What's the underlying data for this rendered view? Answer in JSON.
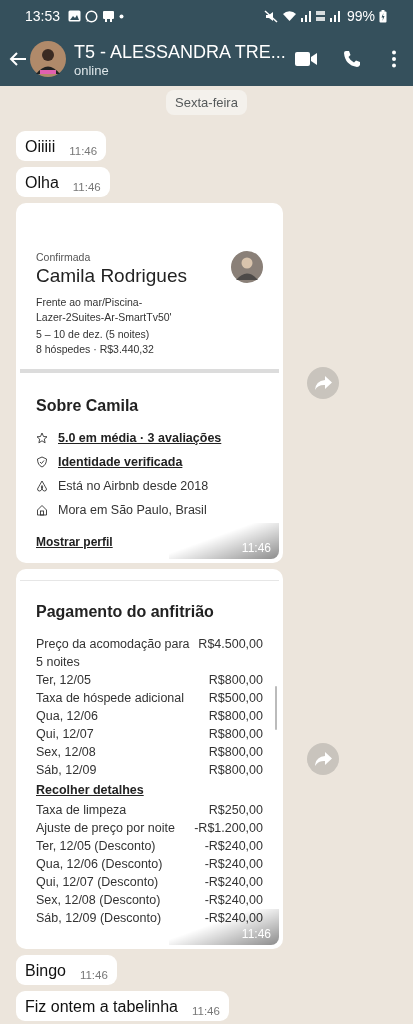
{
  "status_bar": {
    "time": "13:53",
    "battery": "99%"
  },
  "header": {
    "title": "T5 - ALESSANDRA TRE...",
    "status": "online"
  },
  "date_chip": "Sexta-feira",
  "messages": [
    {
      "kind": "text",
      "text": "Oiiiii",
      "time": "11:46"
    },
    {
      "kind": "text",
      "text": "Olha",
      "time": "11:46"
    },
    {
      "kind": "profile_card",
      "time": "11:46",
      "status": "Confirmada",
      "name": "Camila Rodrigues",
      "listing": [
        "Frente ao mar/Piscina-",
        "Lazer-2Suites-Ar-SmartTv50'"
      ],
      "dates": "5 – 10 de dez. (5 noites)",
      "guests_price": "8 hóspedes · R$3.440,32",
      "about_title": "Sobre Camila",
      "facts": [
        {
          "text": "5.0 em média · 3 avaliações",
          "underlined": true
        },
        {
          "text": "Identidade verificada",
          "underlined": true
        },
        {
          "text": "Está no Airbnb desde 2018",
          "underlined": false
        },
        {
          "text": "Mora em São Paulo, Brasil",
          "underlined": false
        }
      ],
      "link": "Mostrar perfil"
    },
    {
      "kind": "payment_card",
      "time": "11:46",
      "title": "Pagamento do anfitrião",
      "rows": [
        {
          "kind": "line",
          "label": "Preço da acomodação para 5 noites",
          "amount": "R$4.500,00"
        },
        {
          "kind": "line",
          "label": "Ter, 12/05",
          "amount": "R$800,00"
        },
        {
          "kind": "line",
          "label": "Taxa de hóspede adicional",
          "amount": "R$500,00"
        },
        {
          "kind": "line",
          "label": "Qua, 12/06",
          "amount": "R$800,00"
        },
        {
          "kind": "line",
          "label": "Qui, 12/07",
          "amount": "R$800,00"
        },
        {
          "kind": "line",
          "label": "Sex, 12/08",
          "amount": "R$800,00"
        },
        {
          "kind": "line",
          "label": "Sáb, 12/09",
          "amount": "R$800,00"
        },
        {
          "kind": "link",
          "label": "Recolher detalhes"
        },
        {
          "kind": "line",
          "label": "Taxa de limpeza",
          "amount": "R$250,00"
        },
        {
          "kind": "line",
          "label": "Ajuste de preço por noite",
          "amount": "-R$1.200,00"
        },
        {
          "kind": "line",
          "label": "Ter, 12/05 (Desconto)",
          "amount": "-R$240,00"
        },
        {
          "kind": "line",
          "label": "Qua, 12/06 (Desconto)",
          "amount": "-R$240,00"
        },
        {
          "kind": "line",
          "label": "Qui, 12/07 (Desconto)",
          "amount": "-R$240,00"
        },
        {
          "kind": "line",
          "label": "Sex, 12/08 (Desconto)",
          "amount": "-R$240,00"
        },
        {
          "kind": "line",
          "label": "Sáb, 12/09 (Desconto)",
          "amount": "-R$240,00"
        }
      ]
    },
    {
      "kind": "text",
      "text": "Bingo",
      "time": "11:46"
    },
    {
      "kind": "text",
      "text": "Fiz ontem a tabelinha",
      "time": "11:46"
    }
  ]
}
